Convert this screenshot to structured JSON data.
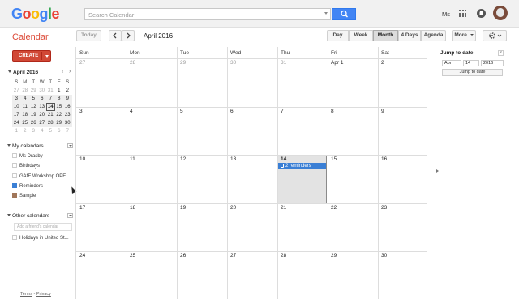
{
  "header": {
    "logo_letters": [
      {
        "ch": "G",
        "color": "#4285f4"
      },
      {
        "ch": "o",
        "color": "#ea4335"
      },
      {
        "ch": "o",
        "color": "#fbbc05"
      },
      {
        "ch": "g",
        "color": "#4285f4"
      },
      {
        "ch": "l",
        "color": "#34a853"
      },
      {
        "ch": "e",
        "color": "#ea4335"
      }
    ],
    "search_placeholder": "Search Calendar",
    "user_name": "Ms"
  },
  "toolbar": {
    "brand": "Calendar",
    "today": "Today",
    "month_title": "April 2016",
    "views": {
      "day": "Day",
      "week": "Week",
      "month": "Month",
      "four_days": "4 Days",
      "agenda": "Agenda"
    },
    "active_view": "Month",
    "more": "More"
  },
  "sidebar": {
    "create": "CREATE",
    "mini_cal": {
      "title": "April 2016",
      "weekday_headers": [
        "S",
        "M",
        "T",
        "W",
        "T",
        "F",
        "S"
      ],
      "weeks": [
        [
          "27",
          "28",
          "29",
          "30",
          "31",
          "1",
          "2"
        ],
        [
          "3",
          "4",
          "5",
          "6",
          "7",
          "8",
          "9"
        ],
        [
          "10",
          "11",
          "12",
          "13",
          "14",
          "15",
          "16"
        ],
        [
          "17",
          "18",
          "19",
          "20",
          "21",
          "22",
          "23"
        ],
        [
          "24",
          "25",
          "26",
          "27",
          "28",
          "29",
          "30"
        ],
        [
          "1",
          "2",
          "3",
          "4",
          "5",
          "6",
          "7"
        ]
      ],
      "selected": "14"
    },
    "my_calendars": {
      "title": "My calendars",
      "items": [
        {
          "label": "Ms Drasby",
          "color": "#ffffff"
        },
        {
          "label": "Birthdays",
          "color": "#ffffff"
        },
        {
          "label": "GAfE Workshop OPE...",
          "color": "#ffffff"
        },
        {
          "label": "Reminders",
          "color": "#3a7fd5"
        },
        {
          "label": "Sample",
          "color": "#a0765a"
        }
      ]
    },
    "other_calendars": {
      "title": "Other calendars",
      "friend_placeholder": "Add a friend's calendar",
      "items": [
        {
          "label": "Holidays in United St...",
          "color": "#ffffff"
        }
      ]
    },
    "footer": {
      "terms": "Terms",
      "sep": " - ",
      "privacy": "Privacy"
    }
  },
  "grid": {
    "weekdays": [
      "Sun",
      "Mon",
      "Tue",
      "Wed",
      "Thu",
      "Fri",
      "Sat"
    ],
    "weeks": [
      [
        "27",
        "28",
        "29",
        "30",
        "31",
        "Apr 1",
        "2"
      ],
      [
        "3",
        "4",
        "5",
        "6",
        "7",
        "8",
        "9"
      ],
      [
        "10",
        "11",
        "12",
        "13",
        "14",
        "15",
        "16"
      ],
      [
        "17",
        "18",
        "19",
        "20",
        "21",
        "22",
        "23"
      ],
      [
        "24",
        "25",
        "26",
        "27",
        "28",
        "29",
        "30"
      ]
    ],
    "today": "14",
    "reminder_chip": "2 reminders"
  },
  "jump": {
    "title": "Jump to date",
    "month": "Apr",
    "day": "14",
    "year": "2016",
    "button": "Jump to date"
  }
}
